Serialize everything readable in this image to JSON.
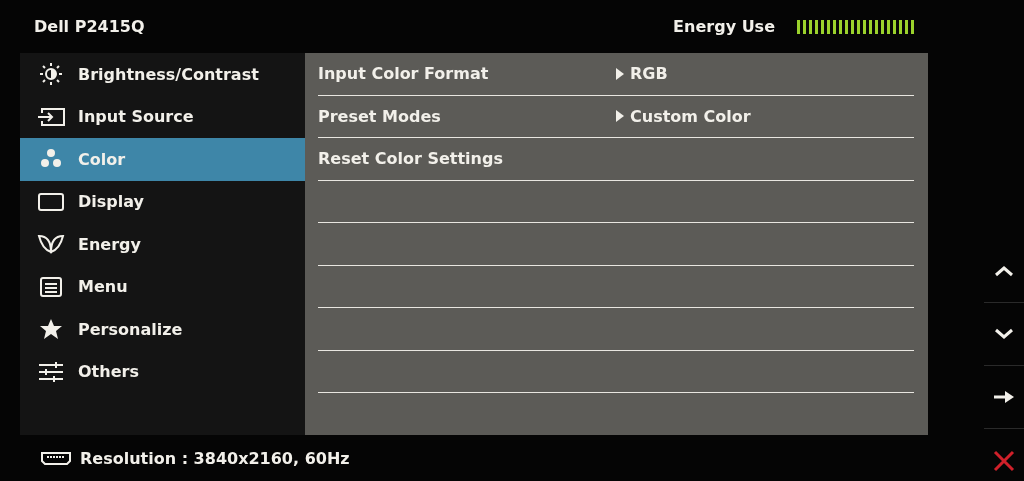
{
  "header": {
    "title": "Dell P2415Q",
    "energy_label": "Energy Use",
    "energy_meter": {
      "level": 1
    }
  },
  "sidebar": {
    "items": [
      {
        "label": "Brightness/Contrast",
        "selected": false
      },
      {
        "label": "Input Source",
        "selected": false
      },
      {
        "label": "Color",
        "selected": true
      },
      {
        "label": "Display",
        "selected": false
      },
      {
        "label": "Energy",
        "selected": false
      },
      {
        "label": "Menu",
        "selected": false
      },
      {
        "label": "Personalize",
        "selected": false
      },
      {
        "label": "Others",
        "selected": false
      }
    ]
  },
  "settings": [
    {
      "label": "Input Color Format",
      "value": "RGB"
    },
    {
      "label": "Preset Modes",
      "value": "Custom Color"
    },
    {
      "label": "Reset Color Settings"
    }
  ],
  "status_bar": {
    "text": "Resolution : 3840x2160, 60Hz"
  }
}
